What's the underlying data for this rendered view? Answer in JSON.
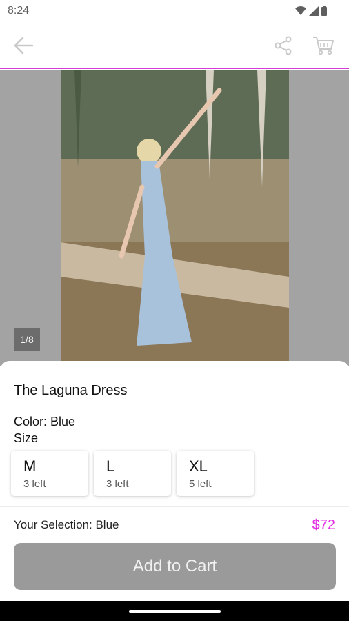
{
  "status_bar": {
    "time": "8:24",
    "icons": [
      "wifi-icon",
      "signal-icon",
      "battery-icon"
    ]
  },
  "app_bar": {
    "accent_color": "#d63bd6",
    "icons": [
      "back-arrow-icon",
      "share-icon",
      "cart-icon"
    ]
  },
  "gallery": {
    "counter": "1/8"
  },
  "product": {
    "title": "The Laguna Dress",
    "color_line": "Color: Blue",
    "size_label": "Size",
    "sizes": [
      {
        "name": "M",
        "stock": "3 left"
      },
      {
        "name": "L",
        "stock": "3 left"
      },
      {
        "name": "XL",
        "stock": "5 left"
      }
    ],
    "selection": "Your Selection: Blue",
    "price": "$72",
    "price_color": "#e22ee2",
    "add_to_cart_label": "Add to Cart"
  }
}
